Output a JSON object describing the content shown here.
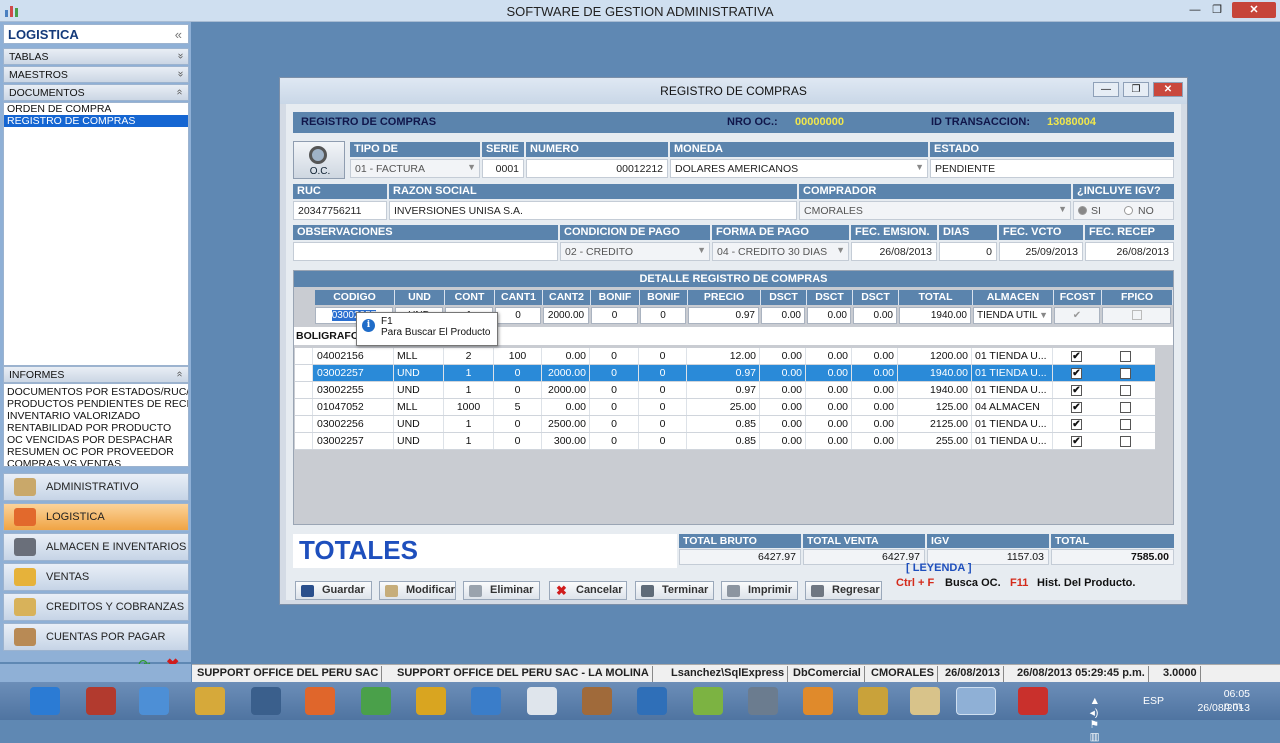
{
  "app": {
    "title": "SOFTWARE DE GESTION ADMINISTRATIVA",
    "minimize": "—",
    "maximize": "❐",
    "close": "✕"
  },
  "sidebar": {
    "header": "LOGISTICA",
    "header_chevron": "«",
    "sections": [
      {
        "label": "TABLAS",
        "chevron": "«"
      },
      {
        "label": "MAESTROS",
        "chevron": "«"
      },
      {
        "label": "DOCUMENTOS",
        "chevron": "«"
      }
    ],
    "documentos": [
      "ORDEN DE COMPRA",
      "REGISTRO DE COMPRAS"
    ],
    "informes_label": "INFORMES",
    "informes": [
      "DOCUMENTOS POR ESTADOS/RUC/F",
      "PRODUCTOS PENDIENTES DE RECIB",
      "INVENTARIO VALORIZADO",
      "RENTABILIDAD POR  PRODUCTO",
      "OC VENCIDAS POR DESPACHAR",
      "RESUMEN OC POR PROVEEDOR",
      "COMPRAS VS VENTAS"
    ],
    "modules": [
      "ADMINISTRATIVO",
      "LOGISTICA",
      "ALMACEN E INVENTARIOS",
      "VENTAS",
      "CREDITOS Y COBRANZAS",
      "CUENTAS POR PAGAR"
    ]
  },
  "window": {
    "title": "REGISTRO DE COMPRAS"
  },
  "header": {
    "title": "REGISTRO DE COMPRAS",
    "nro_label": "NRO OC.:",
    "nro_value": "00000000",
    "id_label": "ID TRANSACCION:",
    "id_value": "13080004"
  },
  "oc_button": "O.C.",
  "form": {
    "tipo_label": "TIPO DE",
    "tipo": "01 - FACTURA",
    "serie_label": "SERIE",
    "serie": "0001",
    "numero_label": "NUMERO",
    "numero": "00012212",
    "moneda_label": "MONEDA",
    "moneda": "DOLARES AMERICANOS",
    "estado_label": "ESTADO",
    "estado": "PENDIENTE",
    "ruc_label": "RUC",
    "ruc": "20347756211",
    "razon_label": "RAZON SOCIAL",
    "razon": "INVERSIONES UNISA S.A.",
    "comprador_label": "COMPRADOR",
    "comprador": "CMORALES",
    "igv_label": "¿INCLUYE IGV?",
    "igv_si": "SI",
    "igv_no": "NO",
    "obs_label": "OBSERVACIONES",
    "obs": "",
    "condicion_label": "CONDICION DE PAGO",
    "condicion": "02 - CREDITO",
    "forma_label": "FORMA DE PAGO",
    "forma": "04 - CREDITO 30 DIAS",
    "emision_label": "FEC. EMSION.",
    "emision": "26/08/2013",
    "dias_label": "DIAS",
    "dias": "0",
    "vcto_label": "FEC. VCTO",
    "vcto": "25/09/2013",
    "recep_label": "FEC. RECEP",
    "recep": "26/08/2013"
  },
  "detalle": {
    "title": "DETALLE REGISTRO DE COMPRAS",
    "columns": [
      "CODIGO",
      "UND",
      "CONT",
      "CANT1",
      "CANT2",
      "BONIF",
      "BONIF",
      "PRECIO",
      "DSCT",
      "DSCT",
      "DSCT",
      "TOTAL",
      "ALMACEN",
      "FCOST",
      "FPICO"
    ],
    "edit": [
      "03002257",
      "UND",
      "1",
      "0",
      "2000.00",
      "0",
      "0",
      "0.97",
      "0.00",
      "0.00",
      "0.00",
      "1940.00",
      "TIENDA UTIL"
    ],
    "product_name": "BOLIGRAFO",
    "rows": [
      [
        "04002156",
        "MLL",
        "2",
        "100",
        "0.00",
        "0",
        "0",
        "12.00",
        "0.00",
        "0.00",
        "0.00",
        "1200.00",
        "01  TIENDA U..."
      ],
      [
        "03002257",
        "UND",
        "1",
        "0",
        "2000.00",
        "0",
        "0",
        "0.97",
        "0.00",
        "0.00",
        "0.00",
        "1940.00",
        "01  TIENDA U..."
      ],
      [
        "03002255",
        "UND",
        "1",
        "0",
        "2000.00",
        "0",
        "0",
        "0.97",
        "0.00",
        "0.00",
        "0.00",
        "1940.00",
        "01  TIENDA U..."
      ],
      [
        "01047052",
        "MLL",
        "1000",
        "5",
        "0.00",
        "0",
        "0",
        "25.00",
        "0.00",
        "0.00",
        "0.00",
        "125.00",
        "04  ALMACEN"
      ],
      [
        "03002256",
        "UND",
        "1",
        "0",
        "2500.00",
        "0",
        "0",
        "0.85",
        "0.00",
        "0.00",
        "0.00",
        "2125.00",
        "01  TIENDA U..."
      ],
      [
        "03002257",
        "UND",
        "1",
        "0",
        "300.00",
        "0",
        "0",
        "0.85",
        "0.00",
        "0.00",
        "0.00",
        "255.00",
        "01  TIENDA U..."
      ]
    ]
  },
  "tooltip": {
    "title": "F1",
    "text": "Para Buscar El Producto"
  },
  "totals": {
    "label": "TOTALES",
    "bruto_label": "TOTAL BRUTO",
    "bruto": "6427.97",
    "venta_label": "TOTAL VENTA",
    "venta": "6427.97",
    "igv_label": "IGV",
    "igv": "1157.03",
    "total_label": "TOTAL",
    "total": "7585.00"
  },
  "buttons": {
    "guardar": "Guardar",
    "modificar": "Modificar",
    "eliminar": "Eliminar",
    "cancelar": "Cancelar",
    "terminar": "Terminar",
    "imprimir": "Imprimir",
    "regresar": "Regresar"
  },
  "leyenda": {
    "title": "[ LEYENDA ]",
    "k1": "Ctrl + F",
    "d1": "Busca OC.",
    "k2": "F11",
    "d2": "Hist. Del Producto."
  },
  "status": [
    "SUPPORT  OFFICE DEL PERU SAC",
    "SUPPORT  OFFICE DEL PERU SAC - LA MOLINA",
    "Lsanchez\\SqlExpress",
    "DbComercial",
    "CMORALES",
    "26/08/2013",
    "26/08/2013 05:29:45 p.m.",
    "3.0000"
  ],
  "tray": {
    "lang": "ESP",
    "time": "06:05 p.m.",
    "date": "26/08/2013"
  },
  "colors": {
    "header_blue": "#5b84ad",
    "highlight": "#f2e84b",
    "selection": "#2a8ad8",
    "totals_text": "#1e4fbd",
    "legend_key": "#d42a1a"
  }
}
